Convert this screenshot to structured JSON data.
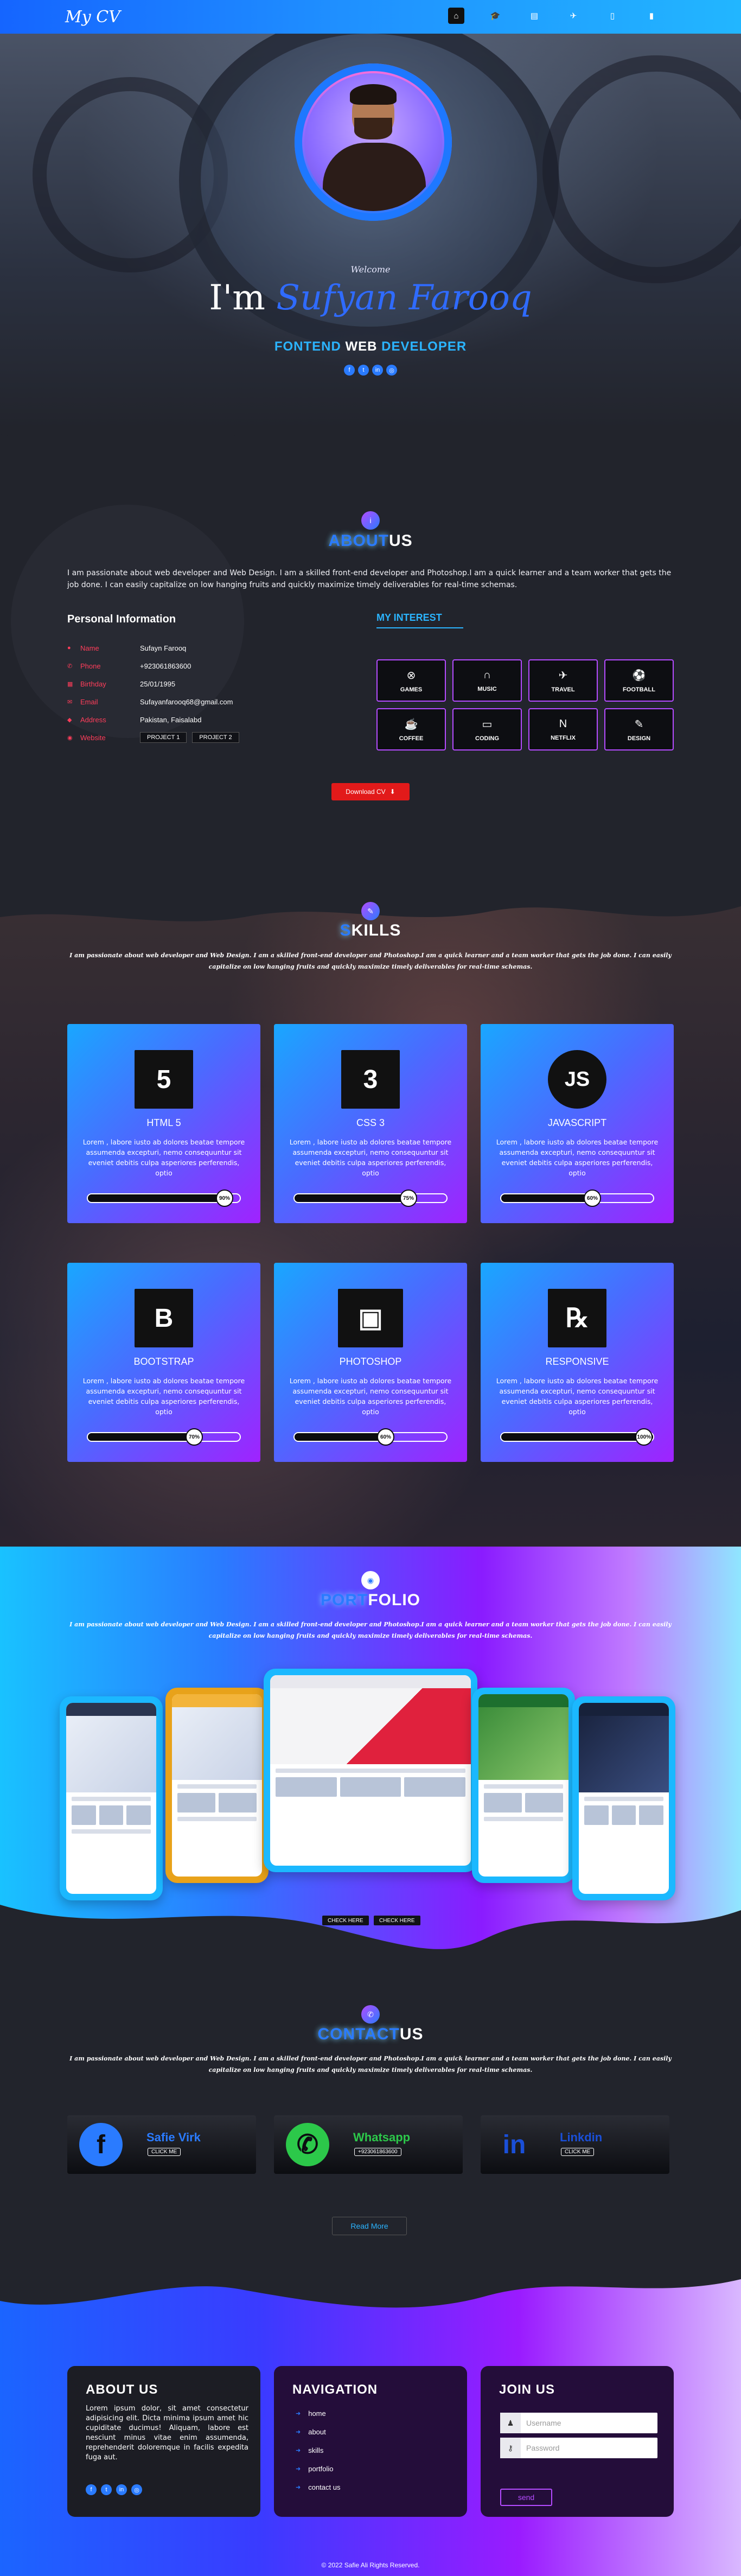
{
  "nav": {
    "logo": "My CV",
    "icons": [
      "home-icon",
      "graduation-cap-icon",
      "id-card-icon",
      "fighter-jet-icon",
      "file-icon",
      "mobile-icon"
    ]
  },
  "hero": {
    "welcome": "Welcome",
    "im": "I'm",
    "name": "Sufyan Farooq",
    "role_a": "FONTEND",
    "role_b": "WEB",
    "role_c": "DEVELOPER",
    "social": [
      "facebook-icon",
      "twitter-icon",
      "linkedin-icon",
      "instagram-icon"
    ]
  },
  "about": {
    "title_hl": "ABOUT",
    "title_pl": "US",
    "text": "I am passionate about web developer and Web Design. I am a skilled front-end developer and Photoshop.I am a quick learner and a team worker that gets the job done. I can easily capitalize on low hanging fruits and quickly maximize timely deliverables for real-time schemas.",
    "personal_title": "Personal Information",
    "rows": [
      {
        "key": "Name",
        "value": "Sufayn Farooq"
      },
      {
        "key": "Phone",
        "value": "+923061863600"
      },
      {
        "key": "Birthday",
        "value": "25/01/1995"
      },
      {
        "key": "Email",
        "value": "Sufayanfarooq68@gmail.com"
      },
      {
        "key": "Address",
        "value": "Pakistan, Faisalabd"
      },
      {
        "key": "Website",
        "value": ""
      }
    ],
    "projects": [
      "PROJECT 1",
      "PROJECT 2"
    ],
    "interest_title": "MY INTEREST",
    "interests": [
      {
        "icon": "gamepad-icon",
        "label": "GAMES"
      },
      {
        "icon": "headphones-icon",
        "label": "MUSIC"
      },
      {
        "icon": "plane-icon",
        "label": "TRAVEL"
      },
      {
        "icon": "football-icon",
        "label": "FOOTBALL"
      },
      {
        "icon": "coffee-icon",
        "label": "COFFEE"
      },
      {
        "icon": "laptop-icon",
        "label": "CODING"
      },
      {
        "icon": "netflix-icon",
        "label": "NETFLIX"
      },
      {
        "icon": "pen-icon",
        "label": "DESIGN"
      }
    ],
    "download": "Download CV"
  },
  "skills": {
    "title_hl": "S",
    "title_pl": "KILLS",
    "desc": "I am passionate about web developer and Web Design. I am a skilled front-end developer and Photoshop.I am a quick learner and a team worker that gets the job done. I can easily capitalize on low hanging fruits and quickly maximize timely deliverables for real-time schemas.",
    "card_text": "Lorem , labore iusto ab dolores beatae tempore assumenda excepturi, nemo consequuntur sit eveniet debitis culpa asperiores perferendis, optio",
    "cards": [
      {
        "name": "HTML 5",
        "glyph": "5",
        "pct": 90,
        "label": "90%"
      },
      {
        "name": "CSS 3",
        "glyph": "3",
        "pct": 75,
        "label": "75%"
      },
      {
        "name": "JAVASCRIPT",
        "glyph": "JS",
        "pct": 60,
        "label": "60%"
      },
      {
        "name": "BOOTSTRAP",
        "glyph": "B",
        "pct": 70,
        "label": "70%"
      },
      {
        "name": "PHOTOSHOP",
        "glyph": "▣",
        "pct": 60,
        "label": "60%"
      },
      {
        "name": "RESPONSIVE",
        "glyph": "℞",
        "pct": 100,
        "label": "100%"
      }
    ]
  },
  "portfolio": {
    "title_hl": "PORT",
    "title_pl": "FOLIO",
    "desc": "I am passionate about web developer and Web Design. I am a skilled front-end developer and Photoshop.I am a quick learner and a team worker that gets the job done. I can easily capitalize on low hanging fruits and quickly maximize timely deliverables for real-time schemas.",
    "buttons": [
      "CHECK HERE",
      "CHECK HERE"
    ]
  },
  "contact": {
    "title_hl": "CONTACT",
    "title_pl": "US",
    "desc": "I am passionate about web developer and Web Design. I am a skilled front-end developer and Photoshop.I am a quick learner and a team worker that gets the job done. I can easily capitalize on low hanging fruits and quickly maximize timely deliverables for real-time schemas.",
    "cards": [
      {
        "icon": "facebook-icon",
        "name": "Safie Virk",
        "sub": "CLICK ME",
        "color": "#2a7bff"
      },
      {
        "icon": "whatsapp-icon",
        "name": "Whatsapp",
        "sub": "+923061863600",
        "color": "#2cc84a"
      },
      {
        "icon": "linkedin-icon",
        "name": "Linkdin",
        "sub": "CLICK ME",
        "color": "#1a4fd8"
      }
    ],
    "read_more": "Read More"
  },
  "footer": {
    "about_title": "ABOUT US",
    "about_text": "Lorem ipsum dolor, sit amet consectetur adipisicing elit. Dicta minima ipsum amet hic cupiditate ducimus! Aliquam, labore est nesciunt minus vitae enim assumenda, reprehenderit doloremque in facilis expedita fuga aut.",
    "nav_title": "NAVIGATION",
    "nav_links": [
      "home",
      "about",
      "skills",
      "portfolio",
      "contact us"
    ],
    "join_title": "JOIN US",
    "username_ph": "Username",
    "password_ph": "Password",
    "send": "send",
    "copyright": "© 2022 Safie Ali Rights Reserved."
  }
}
